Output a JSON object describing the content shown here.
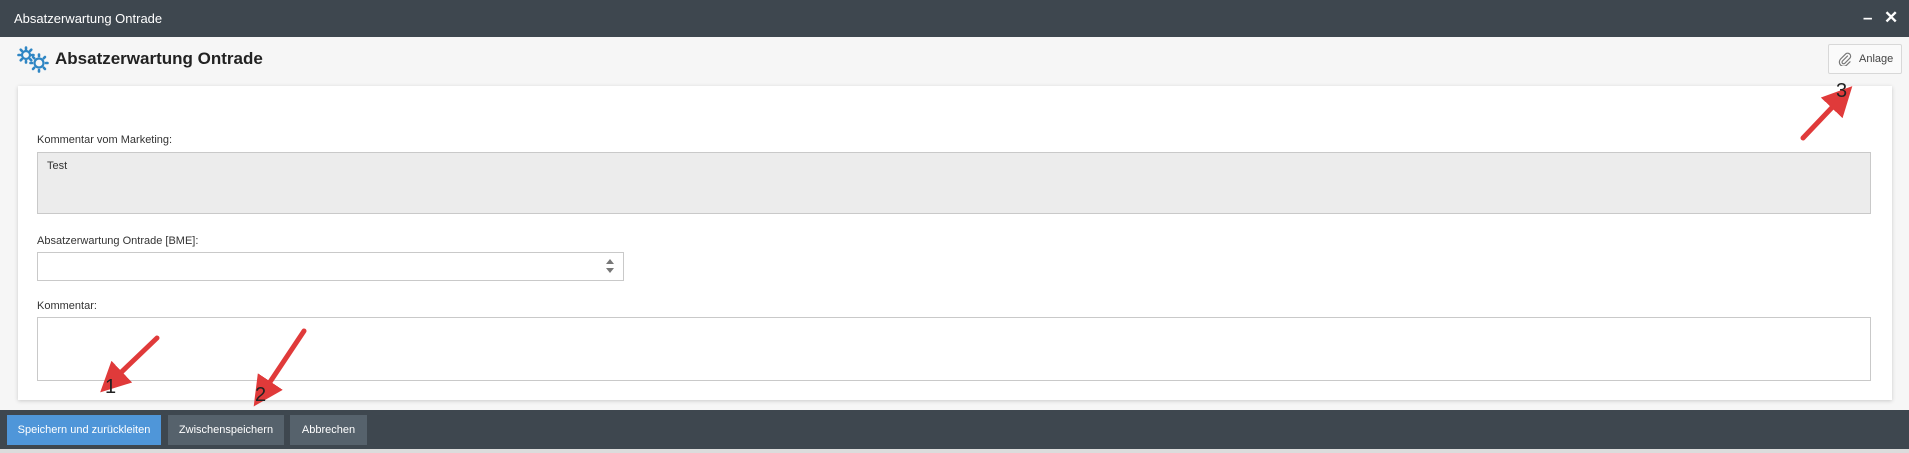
{
  "window": {
    "title": "Absatzerwartung Ontrade",
    "minimize_glyph": "–",
    "close_glyph": "✕"
  },
  "dialog": {
    "title": "Absatzerwartung Ontrade",
    "icon": "gears-icon",
    "attachment_button_label": "Anlage",
    "attachment_icon": "paperclip-icon"
  },
  "form": {
    "marketing_comment": {
      "label": "Kommentar vom Marketing:",
      "value": "Test"
    },
    "expectation": {
      "label": "Absatzerwartung Ontrade [BME]:",
      "value": ""
    },
    "comment": {
      "label": "Kommentar:",
      "value": ""
    }
  },
  "footer": {
    "save_and_forward_label": "Speichern und zurückleiten",
    "intermediate_save_label": "Zwischenspeichern",
    "cancel_label": "Abbrechen"
  },
  "annotations": {
    "marker_1": "1",
    "marker_2": "2",
    "marker_3": "3"
  },
  "colors": {
    "titlebar": "#3e474f",
    "primary_button": "#4f96d9",
    "secondary_button": "#56626c",
    "icon_blue": "#2f86c4",
    "arrow_red": "#e03a3a"
  }
}
